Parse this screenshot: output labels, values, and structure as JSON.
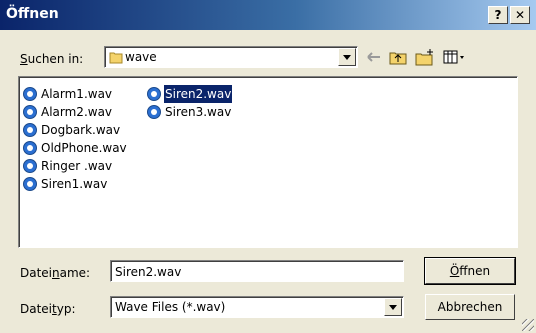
{
  "window": {
    "title": "Öffnen",
    "help_label": "?",
    "close_label": "✕"
  },
  "lookin": {
    "label_pre": "",
    "label_u": "S",
    "label_post": "uchen in:",
    "folder": "wave"
  },
  "toolbar": {
    "back_icon": "back-arrow-icon",
    "up_icon": "folder-up-icon",
    "newfolder_icon": "new-folder-icon",
    "views_icon": "view-menu-icon"
  },
  "files": [
    {
      "name": "Alarm1.wav"
    },
    {
      "name": "Alarm2.wav"
    },
    {
      "name": "Dogbark.wav"
    },
    {
      "name": "OldPhone.wav"
    },
    {
      "name": "Ringer .wav"
    },
    {
      "name": "Siren1.wav"
    },
    {
      "name": "Siren2.wav",
      "selected": true
    },
    {
      "name": "Siren3.wav"
    }
  ],
  "filename": {
    "label_pre": "Datei",
    "label_u": "n",
    "label_post": "ame:",
    "value": "Siren2.wav"
  },
  "filetype": {
    "label_pre": "Datei",
    "label_u": "t",
    "label_post": "yp:",
    "value": "Wave Files (*.wav)"
  },
  "buttons": {
    "open_u": "Ö",
    "open_rest": "ffnen",
    "cancel": "Abbrechen"
  }
}
